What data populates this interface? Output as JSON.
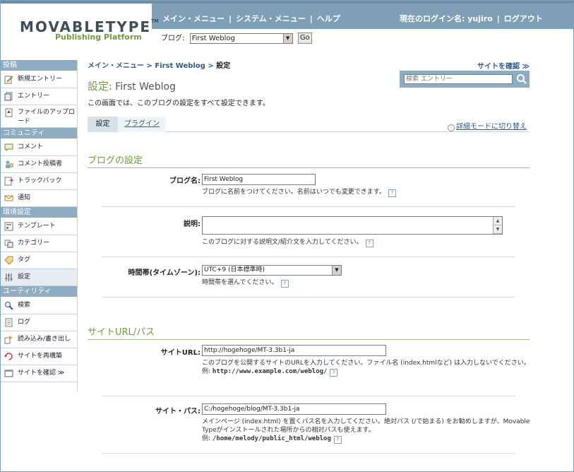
{
  "header": {
    "logo_main": "MOVABLETYPE",
    "logo_tm": "TM",
    "logo_sub": "Publishing Platform",
    "nav": [
      "メイン・メニュー",
      "システム・メニュー",
      "ヘルプ"
    ],
    "user_text": "現在のログイン名: yujiro",
    "logout": "ログアウト",
    "blog_label": "ブログ:",
    "blog_value": "First Weblog",
    "go_label": "Go"
  },
  "sidebar": {
    "sections": [
      {
        "title": "投稿",
        "items": [
          {
            "label": "新規エントリー",
            "icon": "new-entry-icon"
          },
          {
            "label": "エントリー",
            "icon": "entries-icon"
          },
          {
            "label": "ファイルのアップロード",
            "icon": "upload-icon"
          }
        ]
      },
      {
        "title": "コミュニティ",
        "items": [
          {
            "label": "コメント",
            "icon": "comment-icon"
          },
          {
            "label": "コメント投稿者",
            "icon": "commenter-icon"
          },
          {
            "label": "トラックバック",
            "icon": "trackback-icon"
          },
          {
            "label": "通知",
            "icon": "notification-icon"
          }
        ]
      },
      {
        "title": "環境設定",
        "items": [
          {
            "label": "テンプレート",
            "icon": "template-icon"
          },
          {
            "label": "カテゴリー",
            "icon": "category-icon"
          },
          {
            "label": "タグ",
            "icon": "tag-icon"
          },
          {
            "label": "設定",
            "icon": "settings-icon",
            "active": true
          }
        ]
      },
      {
        "title": "ユーティリティ",
        "items": [
          {
            "label": "検索",
            "icon": "search-icon"
          },
          {
            "label": "ログ",
            "icon": "log-icon"
          },
          {
            "label": "読み込み/書き出し",
            "icon": "import-export-icon"
          },
          {
            "label": "サイトを再構築",
            "icon": "rebuild-icon"
          },
          {
            "label": "サイトを確認 ≫",
            "icon": "view-site-icon"
          }
        ]
      }
    ]
  },
  "main": {
    "breadcrumb": {
      "a": "メイン・メニュー",
      "b": "First Weblog",
      "current": "設定",
      "sep": ">"
    },
    "view_site": "サイトを確認 ≫",
    "search_placeholder": "検索 エントリー",
    "title_main": "設定",
    "title_sub": ": First Weblog",
    "description": "この画面では、このブログの設定をすべて設定できます。",
    "tabs": [
      "設定",
      "プラグイン"
    ],
    "detail_mode": "詳細モードに切り替え",
    "blog_section": "ブログの設定",
    "blog_name_label": "ブログ名:",
    "blog_name_value": "First Weblog",
    "blog_name_help": "ブログに名前をつけてください。名前はいつでも変更できます。",
    "desc_label": "説明:",
    "desc_help": "このブログに対する説明文/紹介文を入力してください。",
    "tz_label": "時間帯(タイムゾーン):",
    "tz_value": "UTC+9 (日本標準時)",
    "tz_help": "時間帯を選んでください。",
    "url_section": "サイトURL/パス",
    "site_url_label": "サイトURL:",
    "site_url_value": "http://hogehoge/MT-3.3b1-ja",
    "site_url_help": "このブログを公開するサイトのURLを入力してください。ファイル名 (index.htmlなど) は入力しないでください。",
    "site_url_example_prefix": "例:",
    "site_url_example": "http://www.example.com/weblog/",
    "site_path_label": "サイト・パス:",
    "site_path_value": "C:/hogehoge/blog/MT-3.3b1-ja",
    "site_path_help": "メインページ (index.html) を置くパス名を入力してください。絶対パス (/で始まる) をお勧めしますが、Movable Typeがインストールされた場所からの相対パスも使えます。",
    "site_path_example_prefix": "例:",
    "site_path_example": "/home/melody/public_html/weblog",
    "help_q": "?"
  },
  "colors": {
    "header_band": "#7e9fb5",
    "sidebar_head": "#8eadc2",
    "accent_green": "#6f9a3e",
    "link_blue": "#2d5b8a"
  }
}
